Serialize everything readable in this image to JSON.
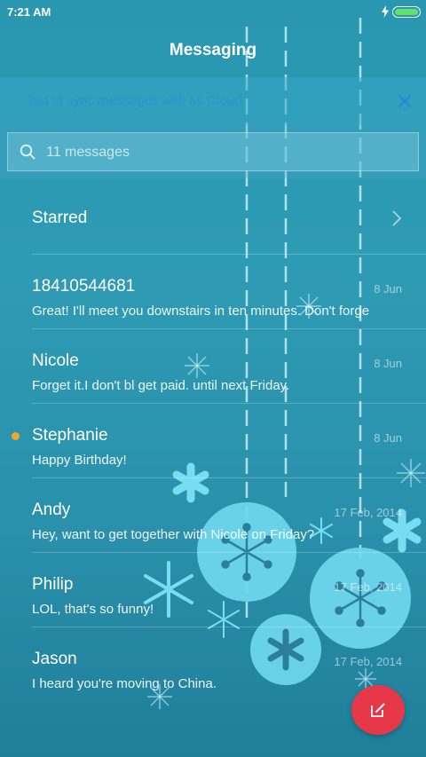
{
  "status_bar": {
    "time": "7:21 AM"
  },
  "header": {
    "title": "Messaging"
  },
  "sync_banner": {
    "text": "Tap to sync messages with Mi Cloud"
  },
  "search": {
    "placeholder": "11 messages"
  },
  "starred": {
    "label": "Starred"
  },
  "conversations": [
    {
      "name": "18410544681",
      "date": "8 Jun",
      "preview": "Great! I'll meet you downstairs in ten minutes. Don't forge",
      "unread": false
    },
    {
      "name": "Nicole",
      "date": "8 Jun",
      "preview": "Forget it.I don't bl get paid. until next Friday.",
      "unread": false
    },
    {
      "name": "Stephanie",
      "date": "8 Jun",
      "preview": "Happy Birthday!",
      "unread": true
    },
    {
      "name": "Andy",
      "date": "17 Feb, 2014",
      "preview": "Hey, want to get together with Nicole on Friday?",
      "unread": false
    },
    {
      "name": "Philip",
      "date": "17 Feb, 2014",
      "preview": "LOL, that's so funny!",
      "unread": false
    },
    {
      "name": "Jason",
      "date": "17 Feb, 2014",
      "preview": "I heard you're moving to China.",
      "unread": false
    }
  ],
  "colors": {
    "background": "#2a97b0",
    "compose_button": "#e7384a",
    "unread_dot": "#f4a62a",
    "battery": "#5fe36a",
    "ornament": "#6fd8ee"
  },
  "icons": [
    "bolt-icon",
    "battery-icon",
    "close-icon",
    "search-icon",
    "chevron-right-icon",
    "compose-icon"
  ]
}
